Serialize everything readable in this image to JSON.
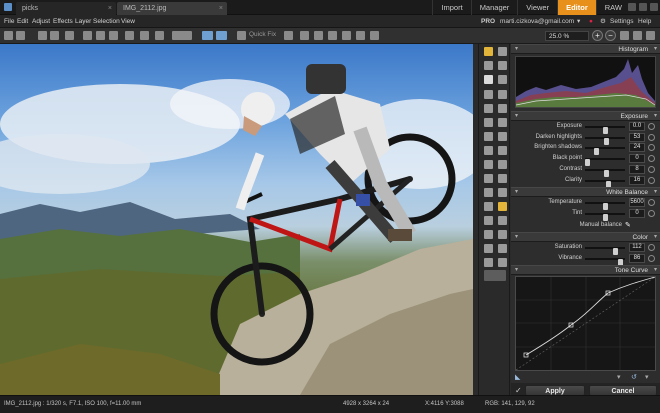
{
  "app": {
    "tabs": [
      {
        "label": "picks"
      },
      {
        "label": "IMG_2112.jpg"
      }
    ],
    "modes": [
      "Import",
      "Manager",
      "Viewer",
      "Editor",
      "RAW"
    ],
    "active_mode": "Editor"
  },
  "menubar": {
    "items": [
      "File",
      "Edit",
      "Adjust",
      "Effects",
      "Layer",
      "Selection",
      "View"
    ],
    "pro_label": "PRO",
    "account": "marti.cizkova@gmail.com",
    "settings_label": "Settings",
    "help_label": "Help"
  },
  "toolbar": {
    "zoom_value": "25.0 %",
    "quick_fix_label": "Quick Fix"
  },
  "panel": {
    "histogram_title": "Histogram",
    "exposure_title": "Exposure",
    "exposure_rows": [
      {
        "label": "Exposure",
        "value": "0.0",
        "level": 0.5
      },
      {
        "label": "Darken highlights",
        "value": "53",
        "level": 0.53
      },
      {
        "label": "Brighten shadows",
        "value": "24",
        "level": 0.24
      },
      {
        "label": "Black point",
        "value": "0",
        "level": 0.0
      },
      {
        "label": "Contrast",
        "value": "8",
        "level": 0.54
      },
      {
        "label": "Clarity",
        "value": "16",
        "level": 0.58
      }
    ],
    "white_balance_title": "White Balance",
    "wb_rows": [
      {
        "label": "Temperature",
        "value": "5600",
        "level": 0.5
      },
      {
        "label": "Tint",
        "value": "0",
        "level": 0.5
      }
    ],
    "manual_balance_label": "Manual balance",
    "color_title": "Color",
    "color_rows": [
      {
        "label": "Saturation",
        "value": "112",
        "level": 0.78
      },
      {
        "label": "Vibrance",
        "value": "86",
        "level": 0.93
      }
    ],
    "tone_curve_title": "Tone Curve",
    "apply_label": "Apply",
    "cancel_label": "Cancel"
  },
  "statusbar": {
    "file_info": "IMG_2112.jpg : 1/320 s, F7.1, ISO 100, f=11.00 mm",
    "dimensions": "4928 x 3264 x 24",
    "coords": "X:4116 Y:3088",
    "rgb": "RGB: 141, 129, 92"
  }
}
